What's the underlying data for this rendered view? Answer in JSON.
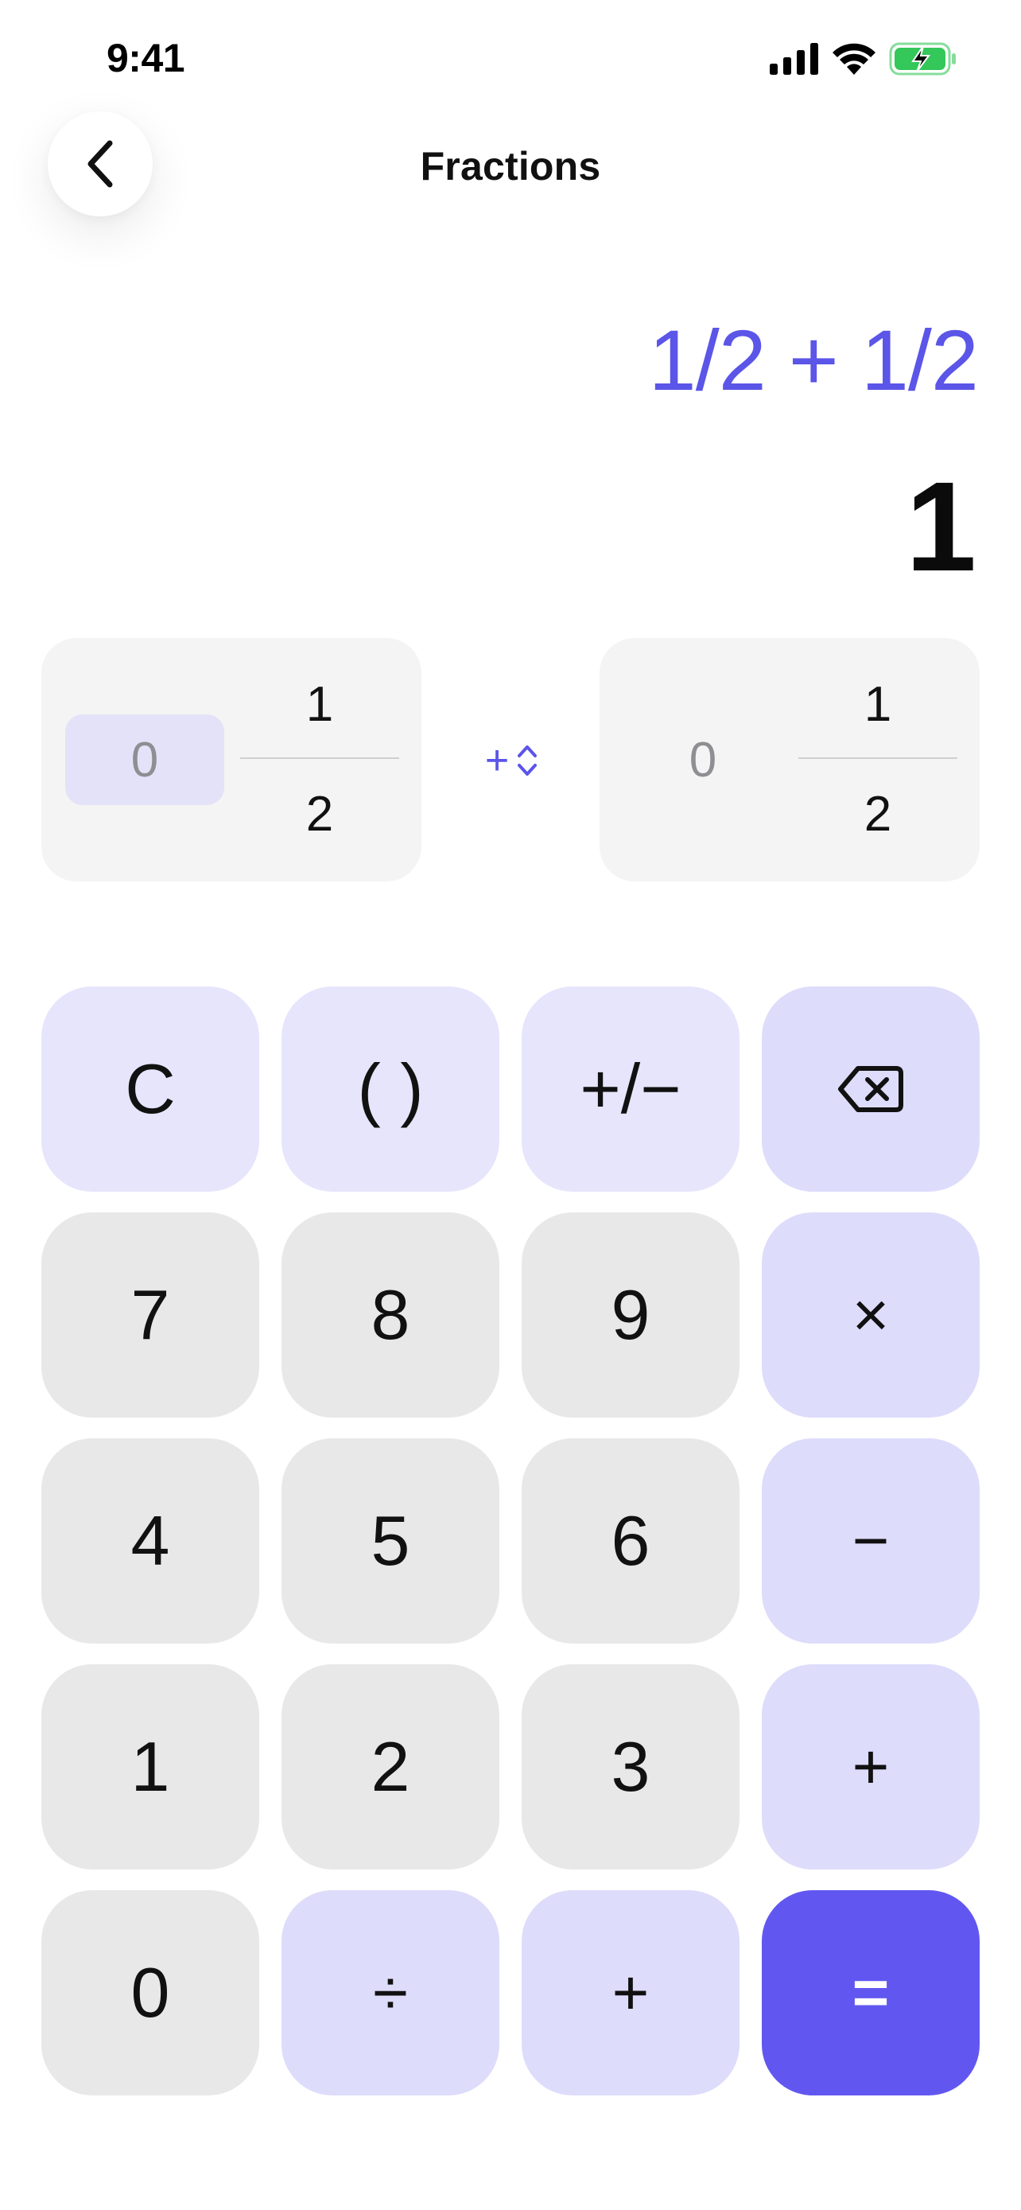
{
  "status_bar": {
    "time": "9:41",
    "icons": [
      "signal-icon",
      "wifi-icon",
      "battery-charging-icon"
    ],
    "battery_color": "#34c759"
  },
  "header": {
    "title": "Fractions",
    "back_icon": "chevron-left-icon"
  },
  "display": {
    "expression": "1/2 + 1/2",
    "result": "1"
  },
  "operand_left": {
    "whole": "0",
    "numerator": "1",
    "denominator": "2",
    "whole_active": true
  },
  "operator_selector": {
    "label": "+",
    "icon": "chevron-up-down-icon"
  },
  "operand_right": {
    "whole": "0",
    "numerator": "1",
    "denominator": "2",
    "whole_active": false
  },
  "keypad": {
    "clear": "C",
    "parens": "( )",
    "sign": "+/−",
    "backspace_icon": "backspace-icon",
    "k7": "7",
    "k8": "8",
    "k9": "9",
    "multiply": "×",
    "k4": "4",
    "k5": "5",
    "k6": "6",
    "minus": "−",
    "k1": "1",
    "k2": "2",
    "k3": "3",
    "plus": "+",
    "k0": "0",
    "divide": "÷",
    "fraction_plus": "+",
    "equals": "="
  },
  "colors": {
    "accent": "#5b55e8",
    "primary_button": "#6157f0",
    "key_gray": "#e8e8e9",
    "key_lavender": "#e6e5fc"
  }
}
